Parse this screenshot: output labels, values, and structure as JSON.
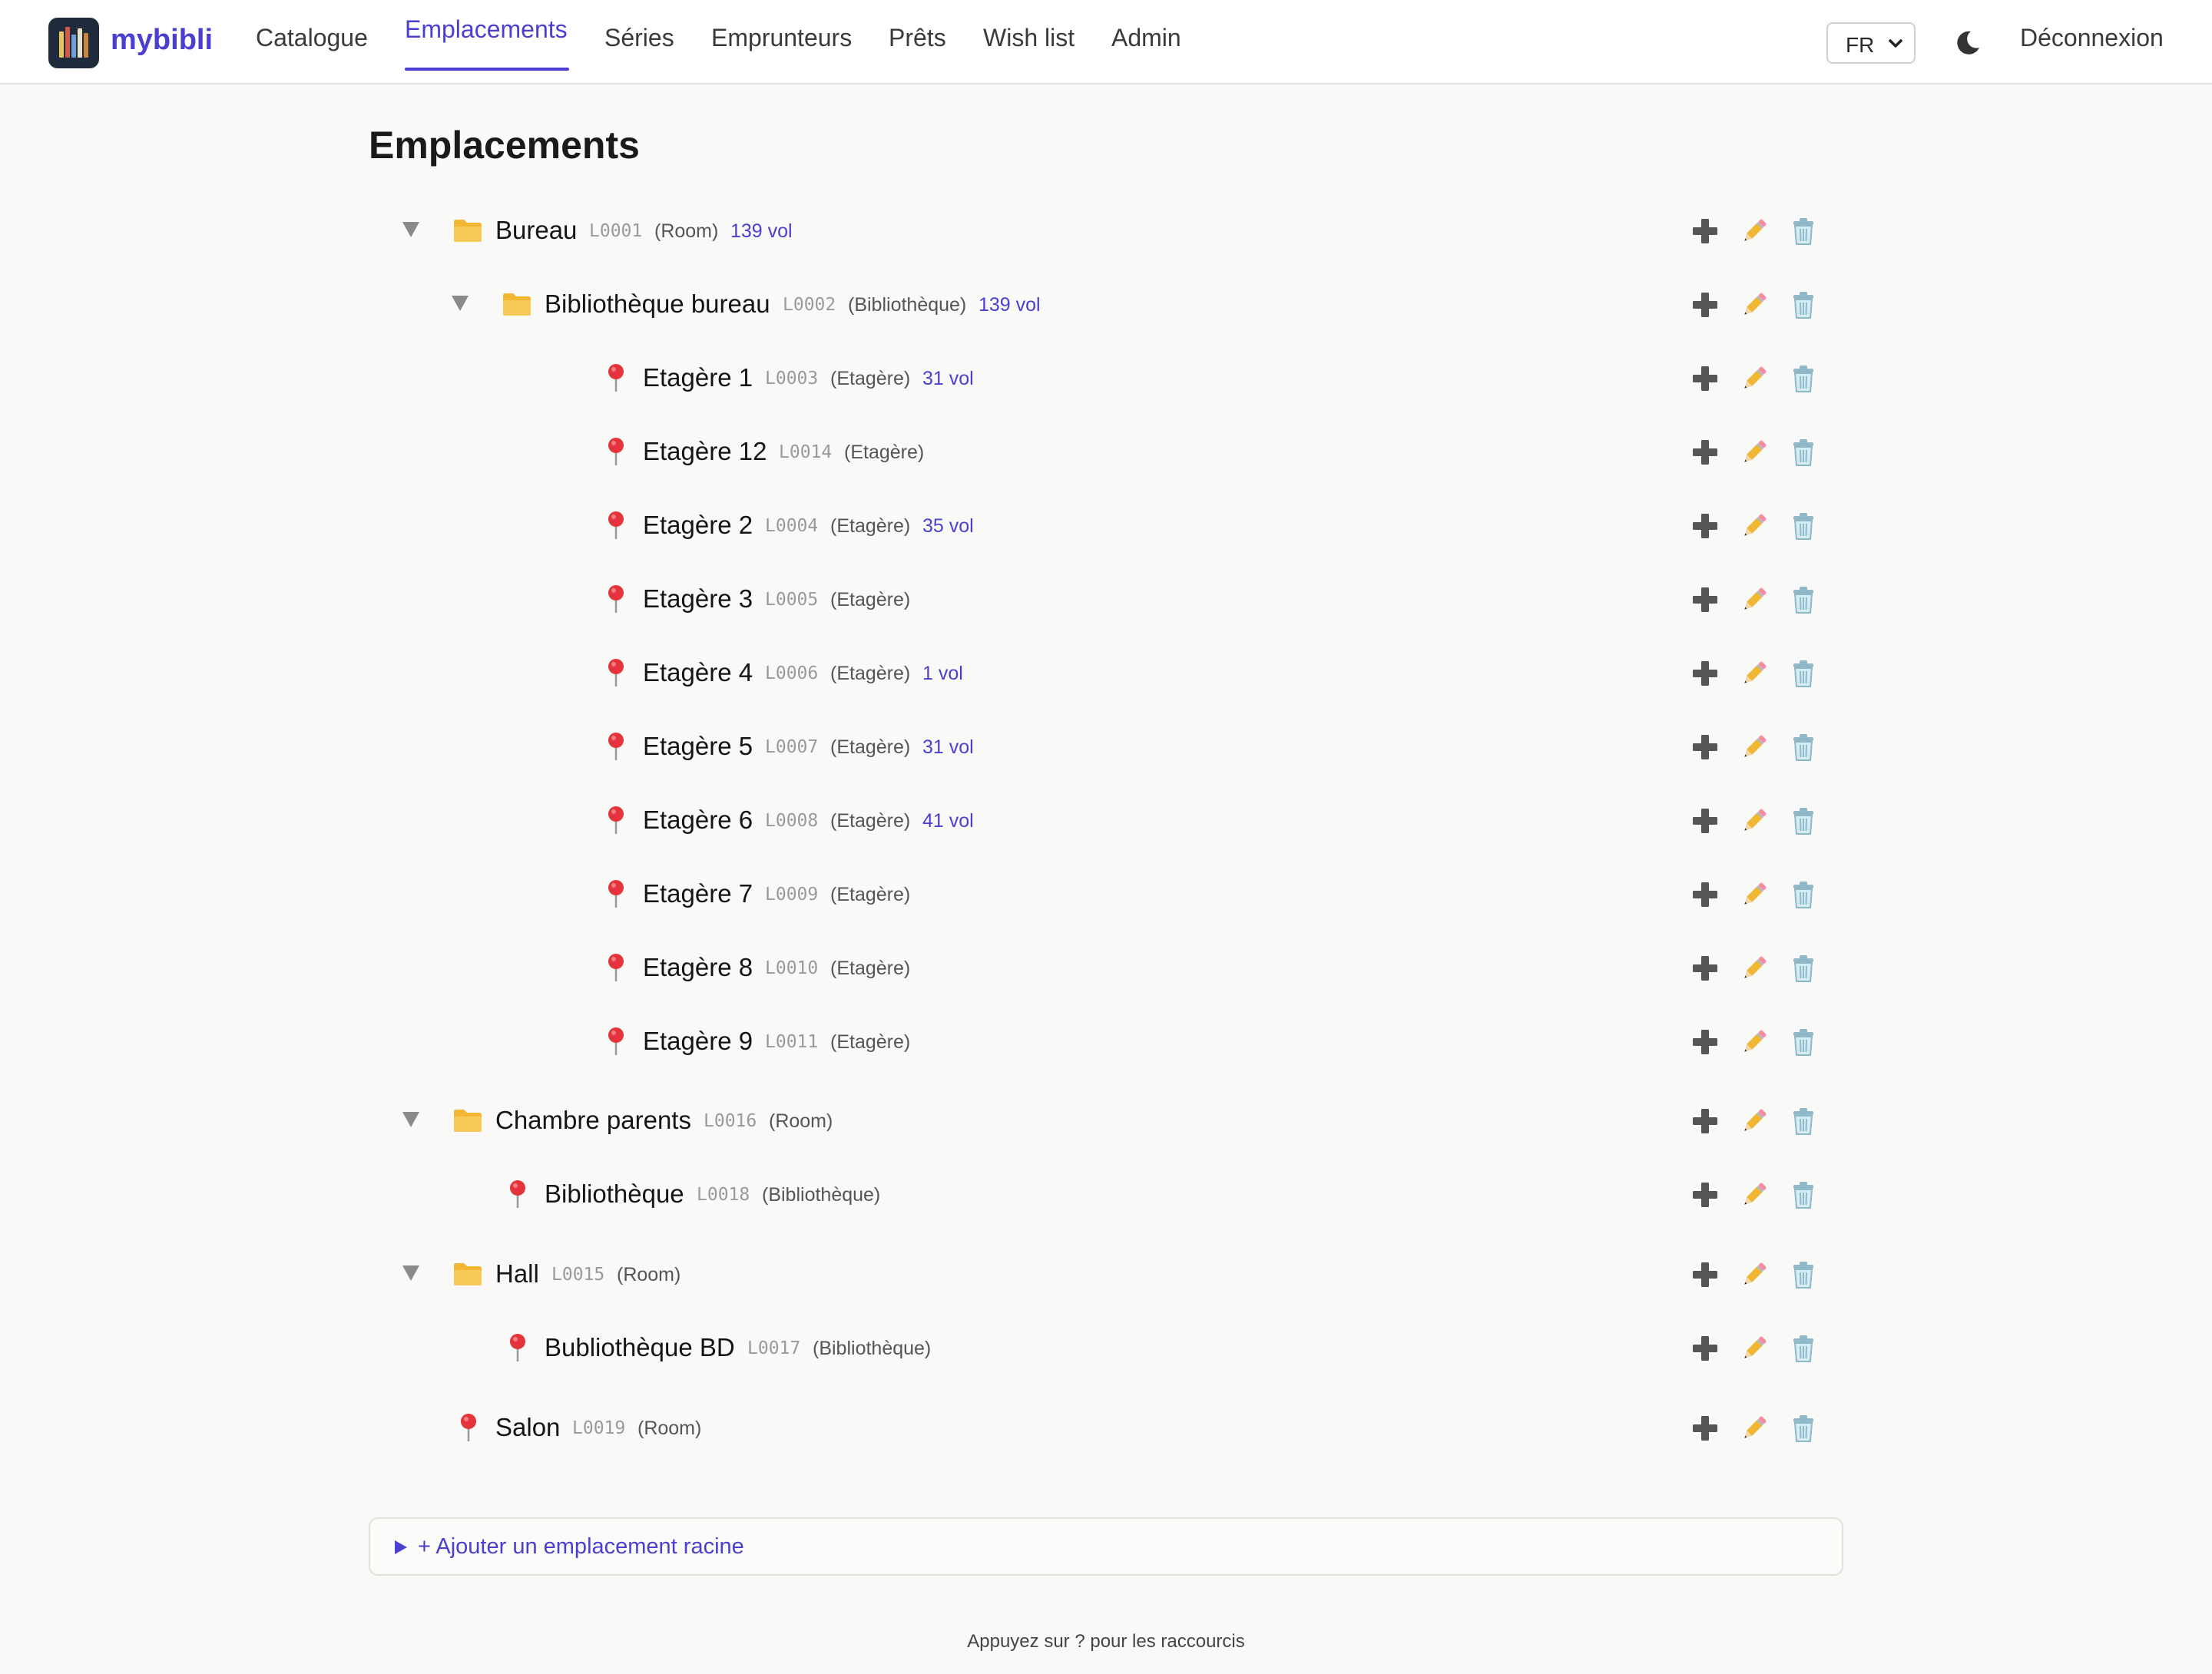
{
  "app": {
    "brand": "mybibli"
  },
  "nav": {
    "items": [
      {
        "label": "Catalogue",
        "active": false
      },
      {
        "label": "Emplacements",
        "active": true
      },
      {
        "label": "Séries",
        "active": false
      },
      {
        "label": "Emprunteurs",
        "active": false
      },
      {
        "label": "Prêts",
        "active": false
      },
      {
        "label": "Wish list",
        "active": false
      },
      {
        "label": "Admin",
        "active": false
      }
    ],
    "language": "FR",
    "theme_icon": "moon-icon",
    "logout": "Déconnexion"
  },
  "page": {
    "title": "Emplacements"
  },
  "locations": [
    {
      "name": "Bureau",
      "code": "L0001",
      "type": "(Room)",
      "vol": "139 vol",
      "level": 0,
      "kind": "folder",
      "expanded": true
    },
    {
      "name": "Bibliothèque bureau",
      "code": "L0002",
      "type": "(Bibliothèque)",
      "vol": "139 vol",
      "level": 1,
      "kind": "folder",
      "expanded": true
    },
    {
      "name": "Etagère 1",
      "code": "L0003",
      "type": "(Etagère)",
      "vol": "31 vol",
      "level": 2,
      "kind": "pin"
    },
    {
      "name": "Etagère 12",
      "code": "L0014",
      "type": "(Etagère)",
      "vol": "",
      "level": 2,
      "kind": "pin"
    },
    {
      "name": "Etagère 2",
      "code": "L0004",
      "type": "(Etagère)",
      "vol": "35 vol",
      "level": 2,
      "kind": "pin"
    },
    {
      "name": "Etagère 3",
      "code": "L0005",
      "type": "(Etagère)",
      "vol": "",
      "level": 2,
      "kind": "pin"
    },
    {
      "name": "Etagère 4",
      "code": "L0006",
      "type": "(Etagère)",
      "vol": "1 vol",
      "level": 2,
      "kind": "pin"
    },
    {
      "name": "Etagère 5",
      "code": "L0007",
      "type": "(Etagère)",
      "vol": "31 vol",
      "level": 2,
      "kind": "pin"
    },
    {
      "name": "Etagère 6",
      "code": "L0008",
      "type": "(Etagère)",
      "vol": "41 vol",
      "level": 2,
      "kind": "pin"
    },
    {
      "name": "Etagère 7",
      "code": "L0009",
      "type": "(Etagère)",
      "vol": "",
      "level": 2,
      "kind": "pin"
    },
    {
      "name": "Etagère 8",
      "code": "L0010",
      "type": "(Etagère)",
      "vol": "",
      "level": 2,
      "kind": "pin"
    },
    {
      "name": "Etagère 9",
      "code": "L0011",
      "type": "(Etagère)",
      "vol": "",
      "level": 2,
      "kind": "pin"
    },
    {
      "name": "Chambre parents",
      "code": "L0016",
      "type": "(Room)",
      "vol": "",
      "level": 0,
      "kind": "folder",
      "expanded": true
    },
    {
      "name": "Bibliothèque",
      "code": "L0018",
      "type": "(Bibliothèque)",
      "vol": "",
      "level": 1,
      "kind": "pin"
    },
    {
      "name": "Hall",
      "code": "L0015",
      "type": "(Room)",
      "vol": "",
      "level": 0,
      "kind": "folder",
      "expanded": true
    },
    {
      "name": "Bubliothèque BD",
      "code": "L0017",
      "type": "(Bibliothèque)",
      "vol": "",
      "level": 1,
      "kind": "pin"
    },
    {
      "name": "Salon",
      "code": "L0019",
      "type": "(Room)",
      "vol": "",
      "level": 0,
      "kind": "pin"
    }
  ],
  "row_actions": {
    "add_icon": "plus-icon",
    "edit_icon": "pencil-icon",
    "delete_icon": "trash-icon"
  },
  "add_root": {
    "label": "+ Ajouter un emplacement racine"
  },
  "footer": {
    "hint": "Appuyez sur ? pour les raccourcis"
  },
  "colors": {
    "accent": "#4a3fd1",
    "background": "#f9f9f7",
    "pin": "#e2343a",
    "folder": "#f2b632"
  }
}
